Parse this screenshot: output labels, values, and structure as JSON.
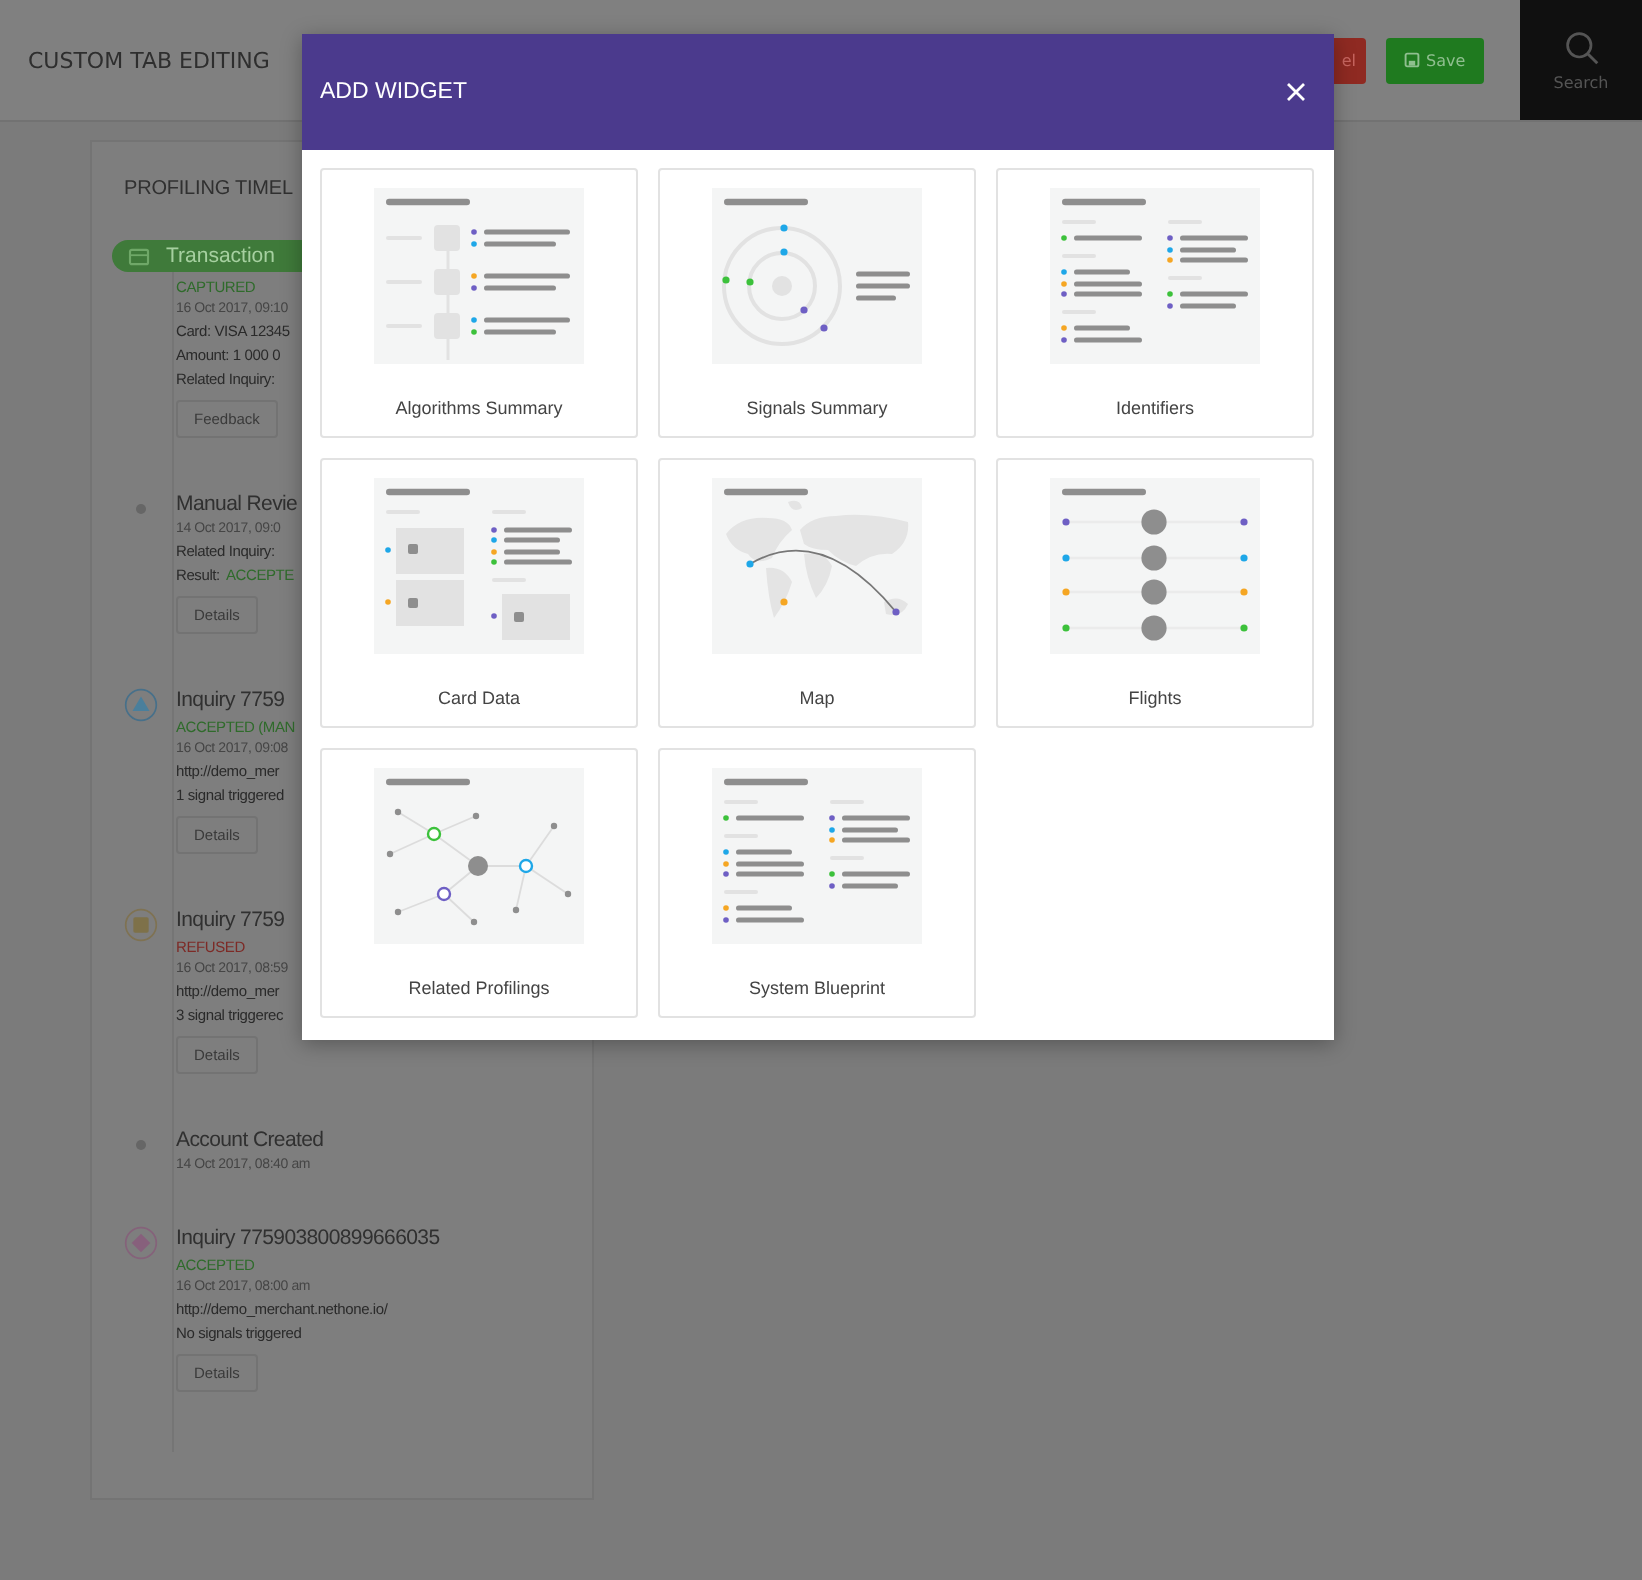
{
  "header": {
    "title": "CUSTOM TAB EDITING",
    "cancel_button": "el",
    "save_button": "Save",
    "search": "Search"
  },
  "timeline": {
    "title": "PROFILING TIMEL",
    "entries": [
      {
        "kind": "transaction",
        "title": "Transaction",
        "status": {
          "text": "CAPTURED",
          "kind": "accepted"
        },
        "date": "16 Oct 2017, 09:10",
        "lines": [
          "Card: VISA 12345",
          "Amount: 1 000 0",
          "Related Inquiry:"
        ],
        "button": "Feedback"
      },
      {
        "kind": "event",
        "title": "Manual Revie",
        "date": "14 Oct 2017, 09:0",
        "lines": [
          "Related Inquiry:"
        ],
        "result": {
          "label": "Result:",
          "value": "ACCEPTE",
          "kind": "accepted"
        },
        "button": "Details"
      },
      {
        "kind": "triangle",
        "title": "Inquiry 7759",
        "status": {
          "text": "ACCEPTED (MAN",
          "kind": "accepted"
        },
        "date": "16 Oct 2017, 09:08",
        "lines": [
          "http://demo_mer",
          "1 signal triggered"
        ],
        "button": "Details"
      },
      {
        "kind": "square",
        "title": "Inquiry 7759",
        "status": {
          "text": "REFUSED",
          "kind": "refused"
        },
        "date": "16 Oct 2017, 08:59",
        "lines": [
          "http://demo_mer",
          "3 signal triggerec"
        ],
        "button": "Details"
      },
      {
        "kind": "event",
        "title": "Account Created",
        "date": "14 Oct 2017, 08:40 am"
      },
      {
        "kind": "diamond",
        "title": "Inquiry 775903800899666035",
        "status": {
          "text": "ACCEPTED",
          "kind": "accepted"
        },
        "date": "16 Oct 2017, 08:00 am",
        "lines": [
          "http://demo_merchant.nethone.io/",
          "No signals triggered"
        ],
        "button": "Details"
      }
    ]
  },
  "modal": {
    "title": "ADD WIDGET",
    "widgets": [
      {
        "kind": "algorithms",
        "label": "Algorithms Summary"
      },
      {
        "kind": "signals",
        "label": "Signals Summary"
      },
      {
        "kind": "identifiers",
        "label": "Identifiers"
      },
      {
        "kind": "card_data",
        "label": "Card Data"
      },
      {
        "kind": "map",
        "label": "Map"
      },
      {
        "kind": "flights",
        "label": "Flights"
      },
      {
        "kind": "related",
        "label": "Related Profilings"
      },
      {
        "kind": "blueprint",
        "label": "System Blueprint"
      }
    ]
  }
}
